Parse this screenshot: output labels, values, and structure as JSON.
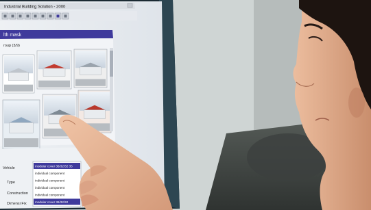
{
  "window": {
    "title": "Industrial Building Solution - 2000",
    "panel_title": "lth mask",
    "group_label": "roup (3/9)"
  },
  "toolbar": {
    "icons": [
      "file-icon",
      "open-icon",
      "save-icon",
      "cut-icon",
      "copy-icon",
      "paste-icon",
      "print-icon",
      "grid-icon",
      "help-icon"
    ]
  },
  "thumbnails": [
    {
      "name": "thumb-warehouse-white"
    },
    {
      "name": "thumb-warehouse-red-roof"
    },
    {
      "name": "thumb-hall-side"
    },
    {
      "name": "thumb-tent-hall"
    },
    {
      "name": "thumb-open-hall"
    },
    {
      "name": "thumb-interior-red"
    }
  ],
  "form": {
    "fields": [
      {
        "label": "Vehicle"
      },
      {
        "label": "Type"
      },
      {
        "label": "Construction"
      },
      {
        "label": "Dimensi Fix"
      }
    ],
    "list_items": [
      "modular cover 36/32/32 35",
      "individual component",
      "individual component",
      "individual component",
      "individual component",
      "modular cover 36/32/32"
    ],
    "selected_index": 0
  },
  "colors": {
    "window_title_bar": "#3f3a9c",
    "monitor_bezel": "#1b2a33",
    "wall": "#c9cfcf",
    "skin": "#e1aa87",
    "hair": "#1d1410",
    "selection": "#3f3a9c"
  }
}
